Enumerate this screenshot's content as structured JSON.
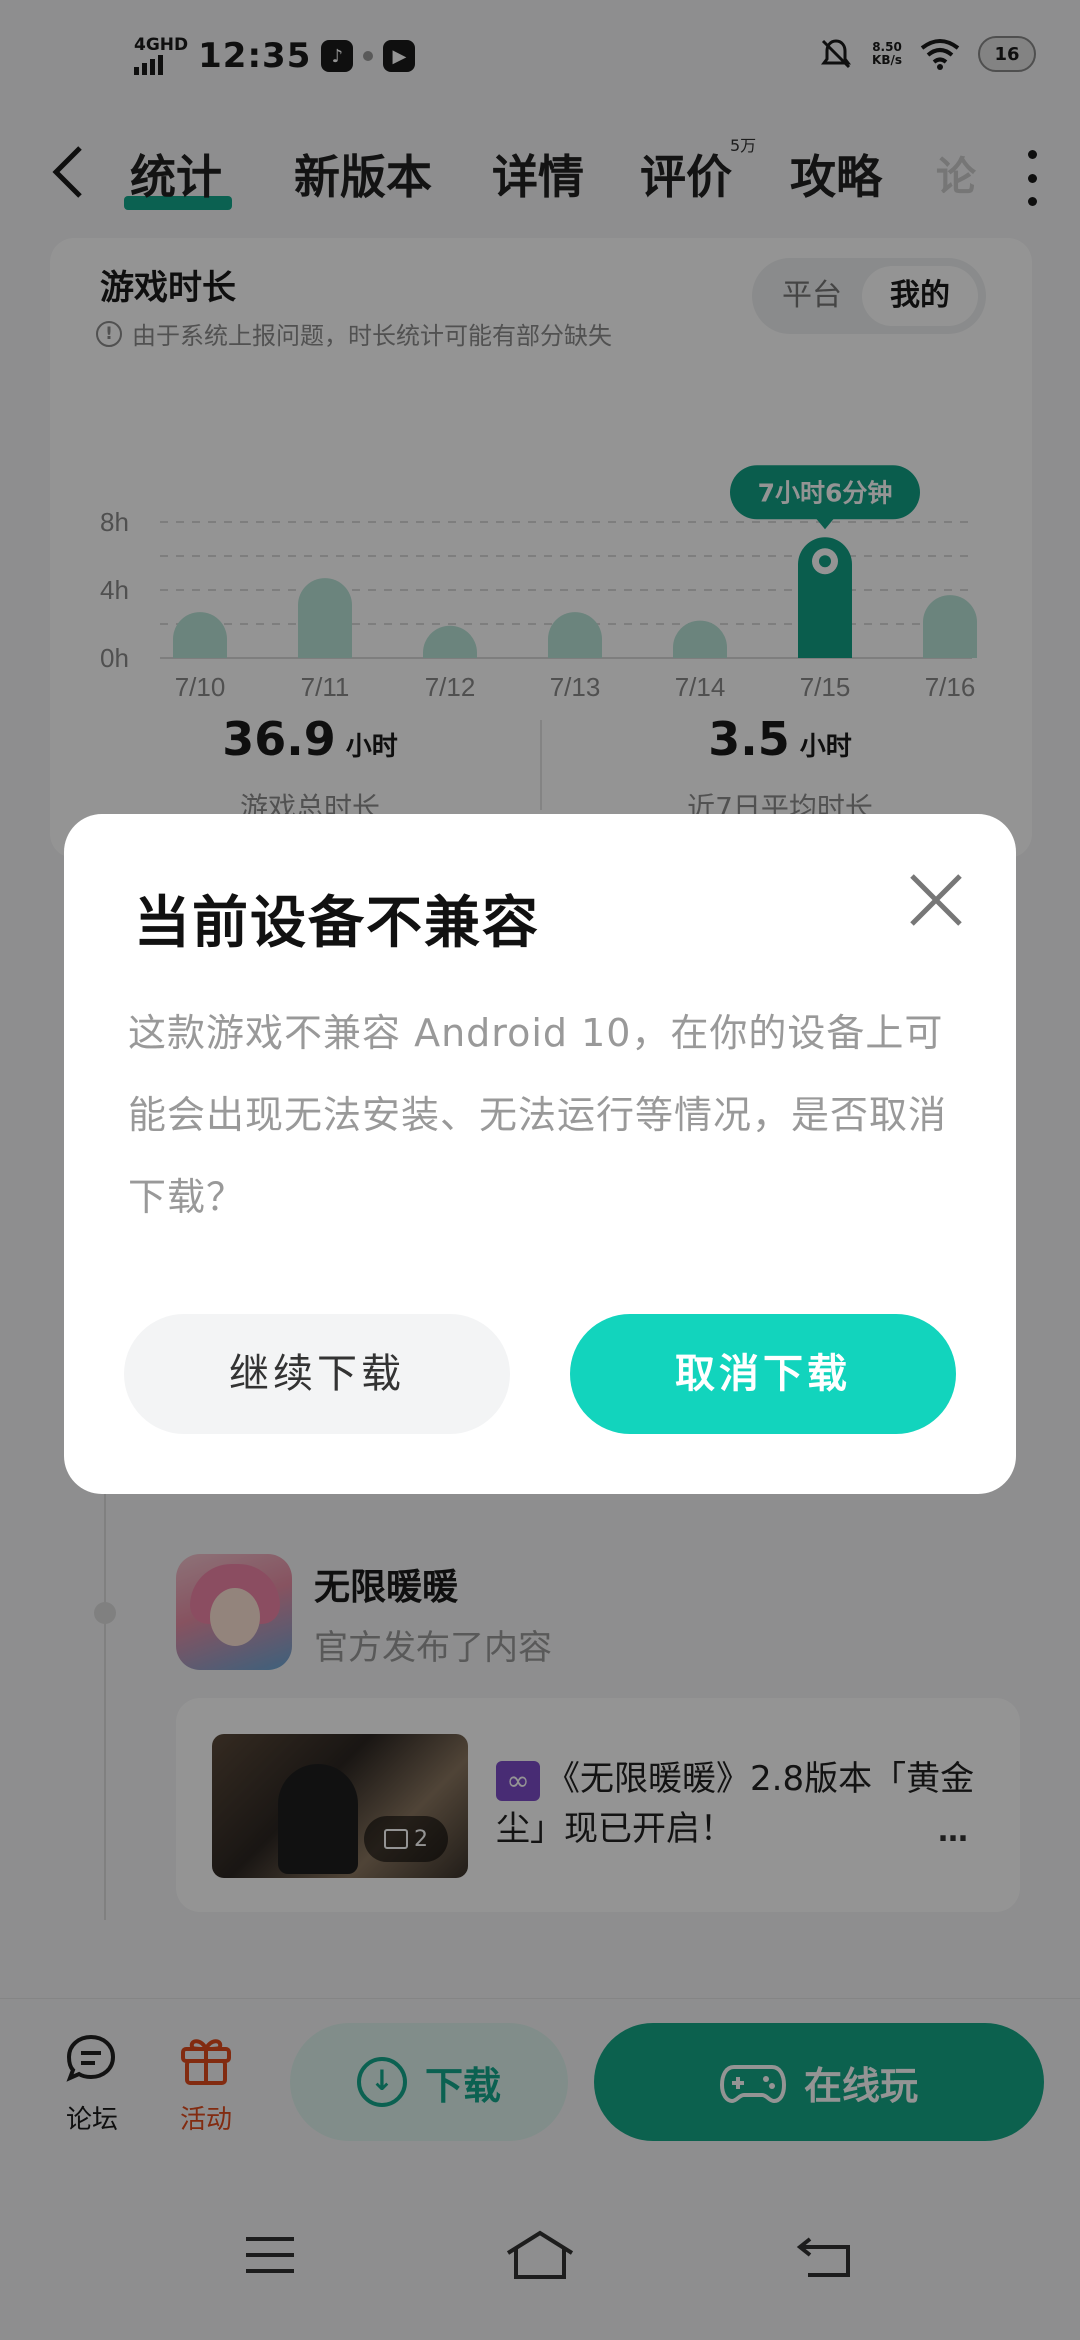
{
  "status_bar": {
    "network": "4GHD",
    "time": "12:35",
    "app_icon_1": "♪",
    "app_icon_2": "▶",
    "net_speed_value": "8.50",
    "net_speed_unit": "KB/s",
    "battery": "16"
  },
  "nav": {
    "tabs": [
      "统计",
      "新版本",
      "详情",
      "评价",
      "攻略",
      "论"
    ],
    "active_tab": 0,
    "review_badge": "5万"
  },
  "stats": {
    "title": "游戏时长",
    "segment": {
      "platform": "平台",
      "mine": "我的"
    },
    "note": "由于系统上报问题，时长统计可能有部分缺失",
    "total_value": "36.9",
    "total_unit": "小时",
    "total_label": "游戏总时长",
    "avg_value": "3.5",
    "avg_unit": "小时",
    "avg_label": "近7日平均时长"
  },
  "chart_data": {
    "type": "bar",
    "categories": [
      "7/10",
      "7/11",
      "7/12",
      "7/13",
      "7/14",
      "7/15",
      "7/16"
    ],
    "values": [
      2.7,
      4.7,
      1.9,
      2.7,
      2.2,
      7.1,
      3.7
    ],
    "y_ticks": [
      "0h",
      "4h",
      "8h"
    ],
    "ylim": [
      0,
      8
    ],
    "highlight_index": 5,
    "highlight_label": "7小时6分钟",
    "colors": {
      "bar": "#b9e3d7",
      "highlight": "#12a186"
    }
  },
  "feed": {
    "name": "无限暖暖",
    "subtitle": "官方发布了内容",
    "post_text": "《无限暖暖》2.8版本「黄金尘」现已开启！",
    "more": "…",
    "image_count": "2",
    "badge_icon": "∞"
  },
  "bottom_bar": {
    "forum": "论坛",
    "event": "活动",
    "download": "下载",
    "play_online": "在线玩"
  },
  "modal": {
    "title": "当前设备不兼容",
    "message": "这款游戏不兼容 Android 10，在你的设备上可能会出现无法安装、无法运行等情况，是否取消下载？",
    "continue_button": "继续下载",
    "cancel_button": "取消下载"
  }
}
